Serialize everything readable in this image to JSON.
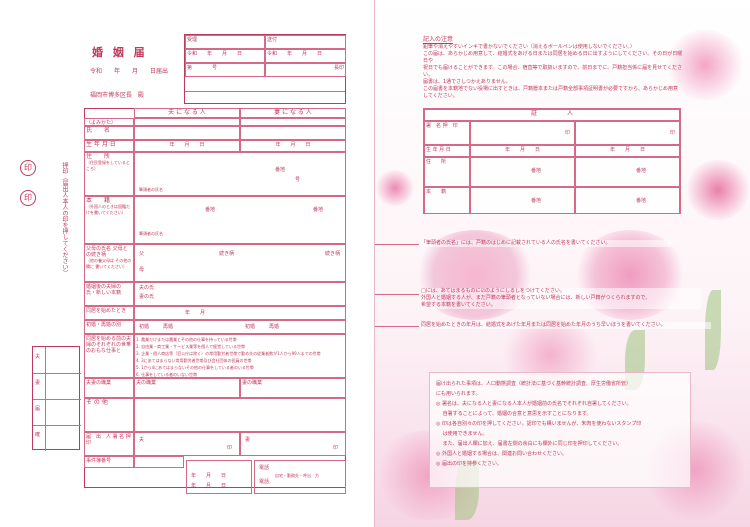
{
  "left": {
    "title": "婚 姻 届",
    "date_line": "令和　　年　　月　　日届出",
    "office": "福岡市博多区長　殿",
    "reception": {
      "received": "受理",
      "date": "令和　　年　　月　　日",
      "no": "第　　　　号",
      "sent": "送付",
      "chief": "長印"
    },
    "columns": {
      "husband": "夫 に な る 人",
      "wife": "妻 に な る 人"
    },
    "rows": {
      "furigana": "（よみかた）",
      "name": "氏　　名",
      "name_sub": "氏　　　　名",
      "birth": "生 年 月 日",
      "address": "住　　所",
      "address_sub": "（住民登録をしているところ）",
      "honseki": "本　　籍",
      "honseki_sub": "（外国人のときは国籍だけを書いてください）",
      "parents": "父母の氏名 父母との続き柄",
      "parents_sub": "（他の養父母は その他の欄に 書いてください）",
      "new_honseki": "婚姻後の夫婦の 氏・新しい本籍",
      "cohabit": "同居を始めたとき",
      "previous": "初婚・再婚の別",
      "household": "同居を始める前の夫婦のそれぞれの世帯のおもな仕事と",
      "occupation": "夫妻の職業",
      "other": "そ の 他",
      "signature": "届　出　人 署 名 押 印",
      "contact": "事件簿番号"
    },
    "fields": {
      "ymd": "年　　月　　日",
      "banchi": "番地",
      "ban": "番",
      "gou": "号",
      "head": "筆頭者の氏名",
      "father": "父",
      "mother": "母",
      "relation": "続き柄",
      "husband_surname": "夫の氏",
      "wife_surname": "妻の氏",
      "marriage_day": "年　　月",
      "first": "初婚",
      "remarry": "再婚",
      "husband_occ": "夫の職業",
      "wife_occ": "妻の職業",
      "husband": "夫",
      "wife": "妻",
      "seal": "印",
      "phone": "電話",
      "home": "自宅・勤務先・呼出　方"
    },
    "household_options": [
      "1. 農業だけまたは農業とその他の仕事を持っている世帯",
      "2. 自由業・商工業・サービス業等を個人で経営している世帯",
      "3. 企業・個人商店等（官公庁は除く）の常用勤労者世帯で勤め先の従業者数が1人から99人までの世帯",
      "4. 3にあてはまらない常用勤労者世帯及び会社団体の役員の世帯",
      "5. 1から4にあてはまらないその他の仕事をしている者のいる世帯",
      "6. 仕事をしている者のいない世帯"
    ],
    "side_note": "押印（届出人本人の印を押してください）",
    "seal_mark": "印",
    "side_table": [
      "夫",
      "妻",
      "氏",
      "名",
      "届",
      "入",
      "住",
      "戸",
      "調",
      "査",
      "確",
      "認",
      "送",
      "付"
    ],
    "witness_label": "証　人"
  },
  "right": {
    "notice_title": "記入の注意",
    "notice_text": [
      "鉛筆や消えやすいインキで書かないでください（消えるボールペンは使用しないでください。）",
      "この届は、あらかじめ用意して、結婚式をあげる日または同居を始める日に出すようにしてください。その日が日曜日や",
      "祝日でも届けることができます。この場合、宿直等で取扱いますので、前日までに、戸籍担当係に届を見せてください。",
      "届書は、1通でさしつかえありません。",
      "この届書を本籍地でない役場に出すときは、戸籍謄本または戸籍全部事項証明書が必要ですから、あらかじめ用意してください。"
    ],
    "witness_header": "証　　　　　人",
    "witness_rows": [
      "署　名 押　印",
      "生 年 月 日",
      "住　　所",
      "本　　籍"
    ],
    "witness_fields": {
      "seal": "印",
      "ymd": "年　　月　　日",
      "banchi": "番地",
      "ban": "番",
      "gou": "号"
    },
    "callout1": "「筆頭者の氏名」には、戸籍のはじめに記載されている人の氏名を書いてください。",
    "callout2": [
      "□には、あてはまるものに☑のようにしるしをつけてください。",
      "外国人と婚姻する人が、まだ戸籍の筆頭者となっていない場合には、新しい戸籍がつくられますので、",
      "希望する本籍を書いてください。"
    ],
    "callout3": "同居を始めたときの年月は、結婚式をあげた年月または同居を始めた年月のうち早いほうを書いてください。",
    "info_lines": [
      "届け出られた事項は、人口動態調査（統計法に基づく基幹統計調査、厚生労働省所管）",
      "にも用いられます。",
      "◎ 署名は、夫になる人と妻になる人本人が婚姻前の氏名でそれぞれ自署してください。",
      "　 自署することによって、婚姻の合意と意思を示すことになります。",
      "◎ 印は各自別々の印を押してください。認印でも構いませんが、朱肉を使わないスタンプ印",
      "　 は使用できません。",
      "　 また、届出人欄に加え、届書左側の余白にも欄外に同じ印を押印してください。",
      "◎ 外国人と婚姻する場合は、関連お問い合わせください。",
      "◎ 届出の印を持参ください。"
    ]
  },
  "colors": {
    "form": "#c0395a",
    "petal": "#f0a8c6",
    "leaf": "#9fc37d"
  }
}
